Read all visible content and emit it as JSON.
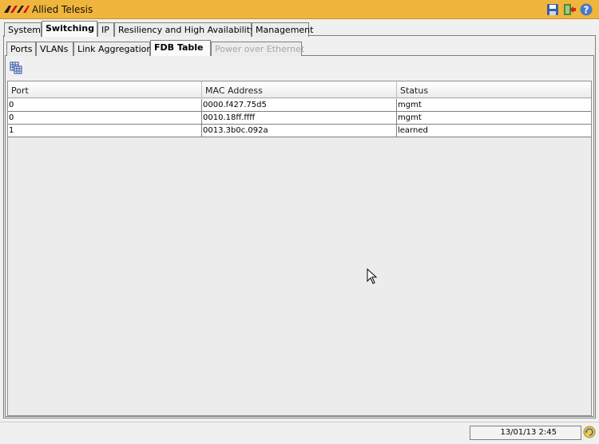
{
  "titlebar": {
    "app_title": "Allied Telesis",
    "logo": "allied-telesis-logo",
    "icons": [
      "save-icon",
      "exit-icon",
      "help-icon"
    ]
  },
  "main_tabs": [
    {
      "label": "System",
      "active": false
    },
    {
      "label": "Switching",
      "active": true
    },
    {
      "label": "IP",
      "active": false
    },
    {
      "label": "Resiliency and High Availability",
      "active": false
    },
    {
      "label": "Management",
      "active": false
    }
  ],
  "sub_tabs": [
    {
      "label": "Ports",
      "active": false,
      "disabled": false
    },
    {
      "label": "VLANs",
      "active": false,
      "disabled": false
    },
    {
      "label": "Link Aggregation",
      "active": false,
      "disabled": false
    },
    {
      "label": "FDB Table",
      "active": true,
      "disabled": false
    },
    {
      "label": "Power over Ethernet",
      "active": false,
      "disabled": true
    }
  ],
  "toolbar": {
    "icon": "grid-columns-icon"
  },
  "table": {
    "columns": [
      "Port",
      "MAC Address",
      "Status"
    ],
    "rows": [
      [
        "0",
        "0000.f427.75d5",
        "mgmt"
      ],
      [
        "0",
        "0010.18ff.ffff",
        "mgmt"
      ],
      [
        "1",
        "0013.3b0c.092a",
        "learned"
      ]
    ]
  },
  "statusbar": {
    "datetime": "13/01/13 2:45",
    "icon": "refresh-icon"
  },
  "colors": {
    "titlebar": "#f0b53c",
    "logo_red": "#d4001c"
  }
}
